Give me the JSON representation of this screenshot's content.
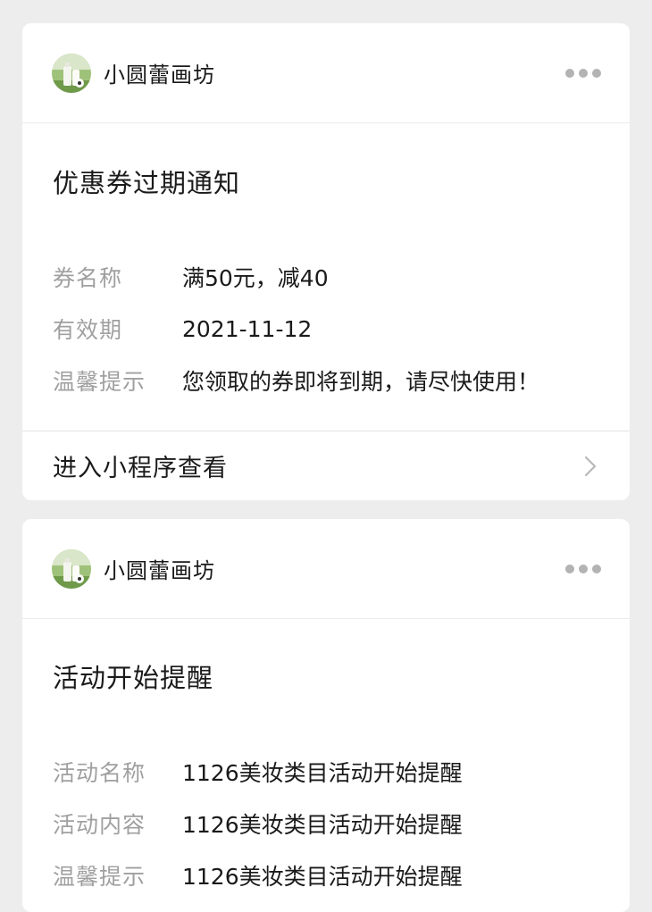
{
  "cards": [
    {
      "account_name": "小圆蕾画坊",
      "avatar_icon": "milk-bottles-avatar",
      "more_icon": "more-dots-icon",
      "title": "优惠券过期通知",
      "rows": [
        {
          "key": "券名称",
          "value": "满50元，减40"
        },
        {
          "key": "有效期",
          "value": "2021-11-12"
        },
        {
          "key": "温馨提示",
          "value": "您领取的券即将到期，请尽快使用！"
        }
      ],
      "footer_label": "进入小程序查看",
      "footer_icon": "chevron-right-icon"
    },
    {
      "account_name": "小圆蕾画坊",
      "avatar_icon": "milk-bottles-avatar",
      "more_icon": "more-dots-icon",
      "title": "活动开始提醒",
      "rows": [
        {
          "key": "活动名称",
          "value": "1126美妆类目活动开始提醒"
        },
        {
          "key": "活动内容",
          "value": "1126美妆类目活动开始提醒"
        },
        {
          "key": "温馨提示",
          "value": "1126美妆类目活动开始提醒"
        }
      ]
    }
  ],
  "colors": {
    "background": "#ededed",
    "card": "#ffffff",
    "key_text": "#a0a0a0",
    "main_text": "#1a1a1a",
    "dots": "#b3b3b3"
  }
}
